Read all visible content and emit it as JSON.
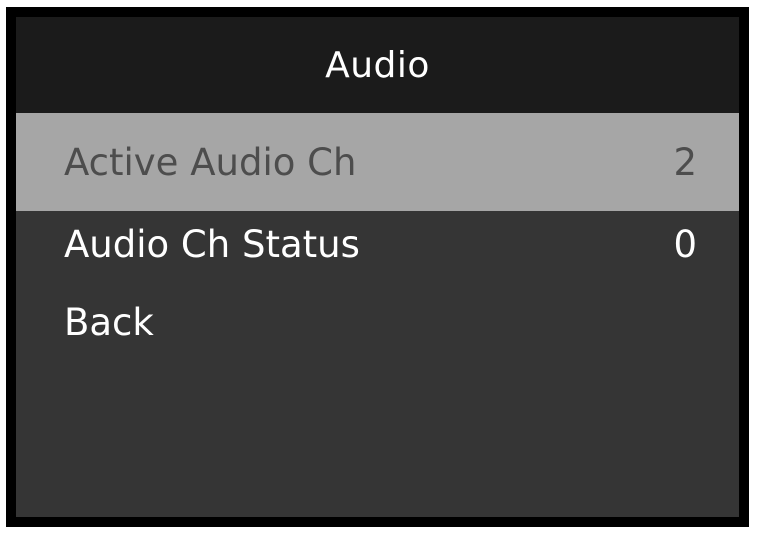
{
  "header": {
    "title": "Audio"
  },
  "menu": {
    "items": [
      {
        "label": "Active Audio Ch",
        "value": "2",
        "selected": true
      },
      {
        "label": "Audio Ch Status",
        "value": "0",
        "selected": false
      },
      {
        "label": "Back",
        "value": "",
        "selected": false
      }
    ]
  },
  "colors": {
    "header_bg": "#1b1b1b",
    "panel_bg": "#353535",
    "selected_bg": "#a6a6a6",
    "selected_text": "#4d4d4d",
    "text": "#ffffff",
    "frame": "#000000"
  }
}
